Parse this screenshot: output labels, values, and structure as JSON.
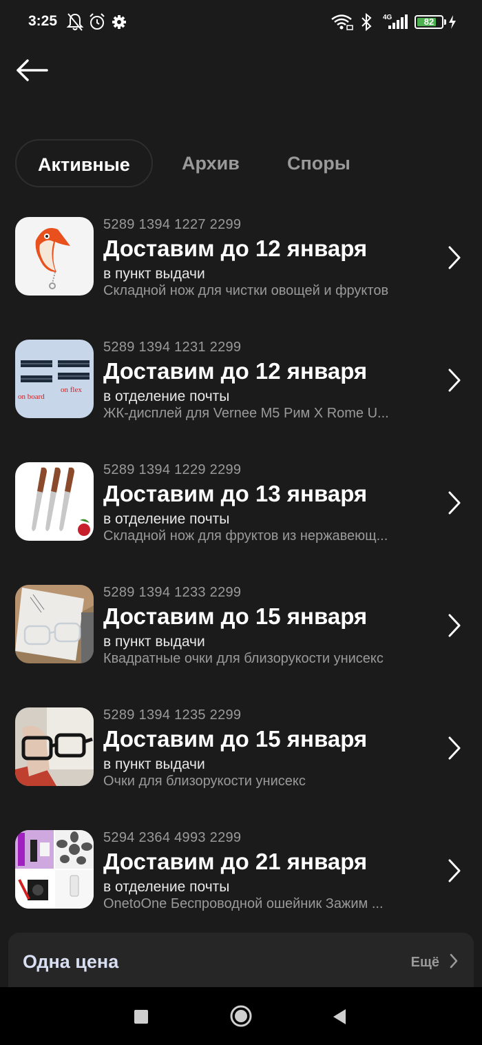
{
  "status_bar": {
    "time": "3:25",
    "network": "4G",
    "battery": 82,
    "icons": [
      "bell-off-icon",
      "alarm-icon",
      "gear-icon",
      "wifi-icon",
      "bluetooth-icon",
      "signal-icon",
      "battery-icon",
      "charging-icon"
    ]
  },
  "tabs": [
    {
      "label": "Активные",
      "active": true
    },
    {
      "label": "Архив",
      "active": false
    },
    {
      "label": "Споры",
      "active": false
    }
  ],
  "orders": [
    {
      "track": "5289 1394 1227 2299",
      "title": "Доставим до 12 января",
      "method": "в пункт выдачи",
      "name": "Складной нож для чистки овощей и фруктов"
    },
    {
      "track": "5289 1394 1231 2299",
      "title": "Доставим до 12 января",
      "method": "в отделение почты",
      "name": "ЖК-дисплей для Vernee M5 Рим X Rome U...",
      "thumb_labels": [
        "on board",
        "on flex"
      ]
    },
    {
      "track": "5289 1394 1229 2299",
      "title": "Доставим до 13 января",
      "method": "в отделение почты",
      "name": "Складной нож для фруктов из нержавеющ..."
    },
    {
      "track": "5289 1394 1233 2299",
      "title": "Доставим до 15 января",
      "method": "в пункт выдачи",
      "name": "Квадратные очки для близорукости унисекс"
    },
    {
      "track": "5289 1394 1235 2299",
      "title": "Доставим до 15 января",
      "method": "в пункт выдачи",
      "name": "Очки для близорукости унисекс"
    },
    {
      "track": "5294 2364 4993 2299",
      "title": "Доставим до 21 января",
      "method": "в отделение почты",
      "name": "OnetoOne Беспроводной ошейник Зажим ..."
    }
  ],
  "promo": {
    "title": "Одна цена",
    "more": "Ещё"
  },
  "colors": {
    "background": "#1b1b1b",
    "card": "#262626",
    "muted": "#9a9a9a",
    "battery": "#4caf50"
  }
}
